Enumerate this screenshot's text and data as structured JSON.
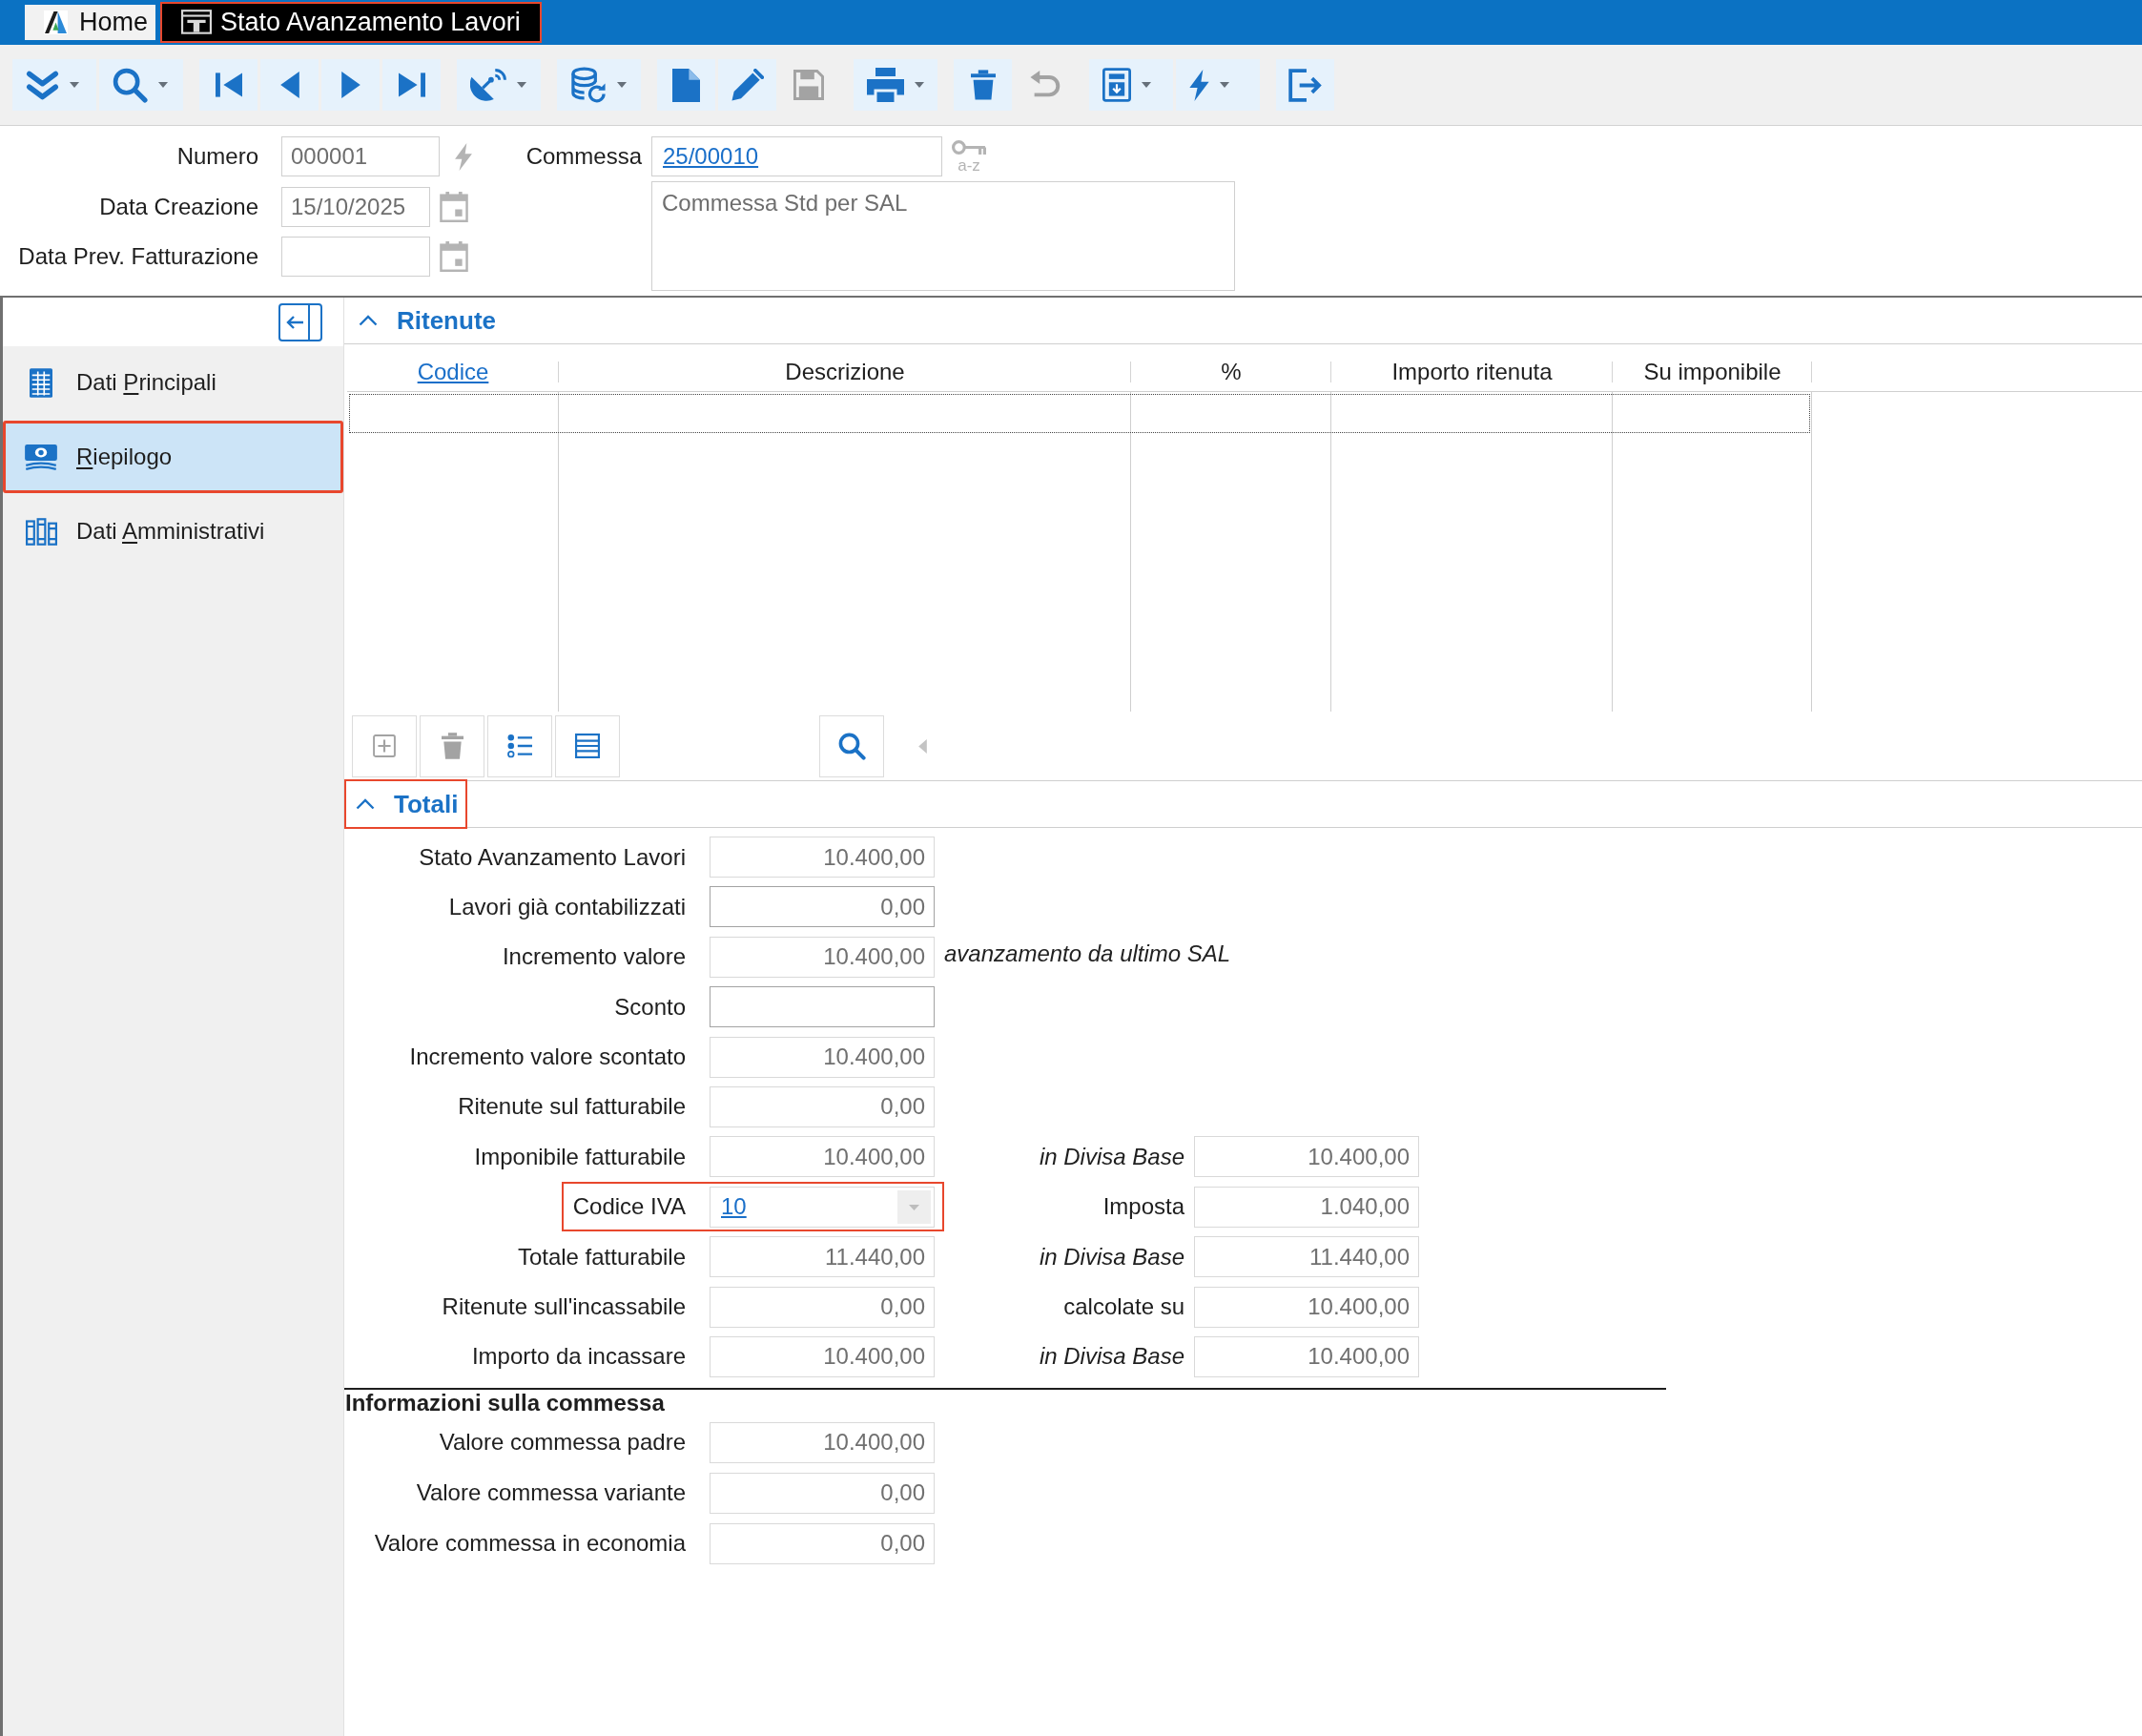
{
  "tabs": [
    {
      "kind": "home",
      "label": "Home",
      "selected": false,
      "highlighted": false
    },
    {
      "kind": "document",
      "label": "Stato Avanzamento Lavori",
      "selected": true,
      "highlighted": true
    }
  ],
  "toolbar": {
    "groups": [
      [
        {
          "kind": "expand",
          "dropdown": true,
          "disabled": false
        },
        {
          "kind": "search",
          "dropdown": true,
          "disabled": false
        }
      ],
      [
        {
          "kind": "first",
          "dropdown": false,
          "disabled": false
        },
        {
          "kind": "previous",
          "dropdown": false,
          "disabled": false
        },
        {
          "kind": "next",
          "dropdown": false,
          "disabled": false
        },
        {
          "kind": "last",
          "dropdown": false,
          "disabled": false
        }
      ],
      [
        {
          "kind": "dish",
          "dropdown": true,
          "disabled": false
        }
      ],
      [
        {
          "kind": "database",
          "dropdown": true,
          "disabled": false
        }
      ],
      [
        {
          "kind": "new",
          "dropdown": false,
          "disabled": false
        },
        {
          "kind": "edit",
          "dropdown": false,
          "disabled": false
        },
        {
          "kind": "save",
          "dropdown": false,
          "disabled": true
        }
      ],
      [
        {
          "kind": "print",
          "dropdown": true,
          "disabled": false
        }
      ],
      [
        {
          "kind": "delete",
          "dropdown": false,
          "disabled": false
        },
        {
          "kind": "undo",
          "dropdown": false,
          "disabled": true
        }
      ],
      [
        {
          "kind": "report",
          "dropdown": true,
          "disabled": false
        },
        {
          "kind": "action",
          "dropdown": true,
          "disabled": false
        }
      ],
      [
        {
          "kind": "exit",
          "dropdown": false,
          "disabled": false
        }
      ]
    ]
  },
  "header": {
    "fields": [
      {
        "kind": "generate",
        "label": "Numero",
        "value": "000001"
      },
      {
        "kind": "date",
        "label": "Data Creazione",
        "value": "15/10/2025"
      },
      {
        "kind": "date",
        "label": "Data Prev. Fatturazione"
      }
    ],
    "commessa": {
      "label": "Commessa",
      "value": "25/00010",
      "lookup_caption": "a-z",
      "description": "Commessa Std per SAL"
    }
  },
  "sidebar": {
    "items": [
      {
        "kind": "table",
        "label": "Dati Principali",
        "mnemonic_underlined": true,
        "selected": false,
        "highlighted": false
      },
      {
        "kind": "money",
        "label": "Riepilogo",
        "mnemonic_underlined": true,
        "selected": true,
        "highlighted": true
      },
      {
        "kind": "books",
        "label": "Dati Amministrativi",
        "mnemonic_underlined": true,
        "selected": false,
        "highlighted": false
      }
    ]
  },
  "ritenute": {
    "title": "Ritenute",
    "expanded": true,
    "highlighted": false,
    "columns": [
      {
        "label": "Codice",
        "link": true
      },
      {
        "label": "Descrizione",
        "link": false
      },
      {
        "label": "%",
        "link": false
      },
      {
        "label": "Importo ritenuta",
        "link": false
      },
      {
        "label": "Su imponibile",
        "link": false
      }
    ],
    "empty_row_focused": true,
    "toolbar": [
      {
        "kind": "add",
        "disabled": true
      },
      {
        "kind": "delete",
        "disabled": true
      },
      {
        "kind": "list",
        "disabled": false
      },
      {
        "kind": "detail",
        "disabled": false
      }
    ],
    "toolbar_right": [
      {
        "kind": "search",
        "disabled": false
      }
    ]
  },
  "totali": {
    "title": "Totali",
    "expanded": true,
    "highlighted": true,
    "rows": [
      {
        "label": "Stato Avanzamento Lavori",
        "highlighted": false,
        "field": {
          "kind": "number",
          "value": "10.400,00",
          "editable": false
        }
      },
      {
        "label": "Lavori già contabilizzati",
        "highlighted": false,
        "field": {
          "kind": "number",
          "value": "0,00",
          "editable": true
        }
      },
      {
        "label": "Incremento valore",
        "highlighted": false,
        "field": {
          "kind": "number",
          "value": "10.400,00",
          "editable": false
        },
        "note": "avanzamento da ultimo SAL"
      },
      {
        "label": "Sconto",
        "highlighted": false,
        "field": {
          "kind": "number",
          "editable": true
        }
      },
      {
        "label": "Incremento valore scontato",
        "highlighted": false,
        "field": {
          "kind": "number",
          "value": "10.400,00",
          "editable": false
        }
      },
      {
        "label": "Ritenute sul fatturabile",
        "highlighted": false,
        "field": {
          "kind": "number",
          "value": "0,00",
          "editable": false
        }
      },
      {
        "label": "Imponibile fatturabile",
        "highlighted": false,
        "field": {
          "kind": "number",
          "value": "10.400,00",
          "editable": false
        },
        "side": {
          "label": "in Divisa Base",
          "italic": true,
          "field": {
            "kind": "number",
            "value": "10.400,00",
            "editable": false
          }
        }
      },
      {
        "label": "Codice IVA",
        "highlighted": true,
        "field": {
          "kind": "combo",
          "value": "10",
          "editable": false
        },
        "side": {
          "label": "Imposta",
          "italic": false,
          "field": {
            "kind": "number",
            "value": "1.040,00",
            "editable": false
          }
        }
      },
      {
        "label": "Totale fatturabile",
        "highlighted": false,
        "field": {
          "kind": "number",
          "value": "11.440,00",
          "editable": false
        },
        "side": {
          "label": "in Divisa Base",
          "italic": true,
          "field": {
            "kind": "number",
            "value": "11.440,00",
            "editable": false
          }
        }
      },
      {
        "label": "Ritenute sull'incassabile",
        "highlighted": false,
        "field": {
          "kind": "number",
          "value": "0,00",
          "editable": false
        },
        "side": {
          "label": "calcolate su",
          "italic": false,
          "field": {
            "kind": "number",
            "value": "10.400,00",
            "editable": false
          }
        }
      },
      {
        "label": "Importo da incassare",
        "highlighted": false,
        "field": {
          "kind": "number",
          "value": "10.400,00",
          "editable": false
        },
        "side": {
          "label": "in Divisa Base",
          "italic": true,
          "field": {
            "kind": "number",
            "value": "10.400,00",
            "editable": false
          }
        }
      }
    ]
  },
  "informazioni": {
    "title": "Informazioni sulla commessa",
    "rows": [
      {
        "label": "Valore commessa padre",
        "highlighted": false,
        "field": {
          "kind": "number",
          "value": "10.400,00",
          "editable": false
        }
      },
      {
        "label": "Valore commessa variante",
        "highlighted": false,
        "field": {
          "kind": "number",
          "value": "0,00",
          "editable": false
        }
      },
      {
        "label": "Valore commessa in economia",
        "highlighted": false,
        "field": {
          "kind": "number",
          "value": "0,00",
          "editable": false
        }
      }
    ]
  }
}
